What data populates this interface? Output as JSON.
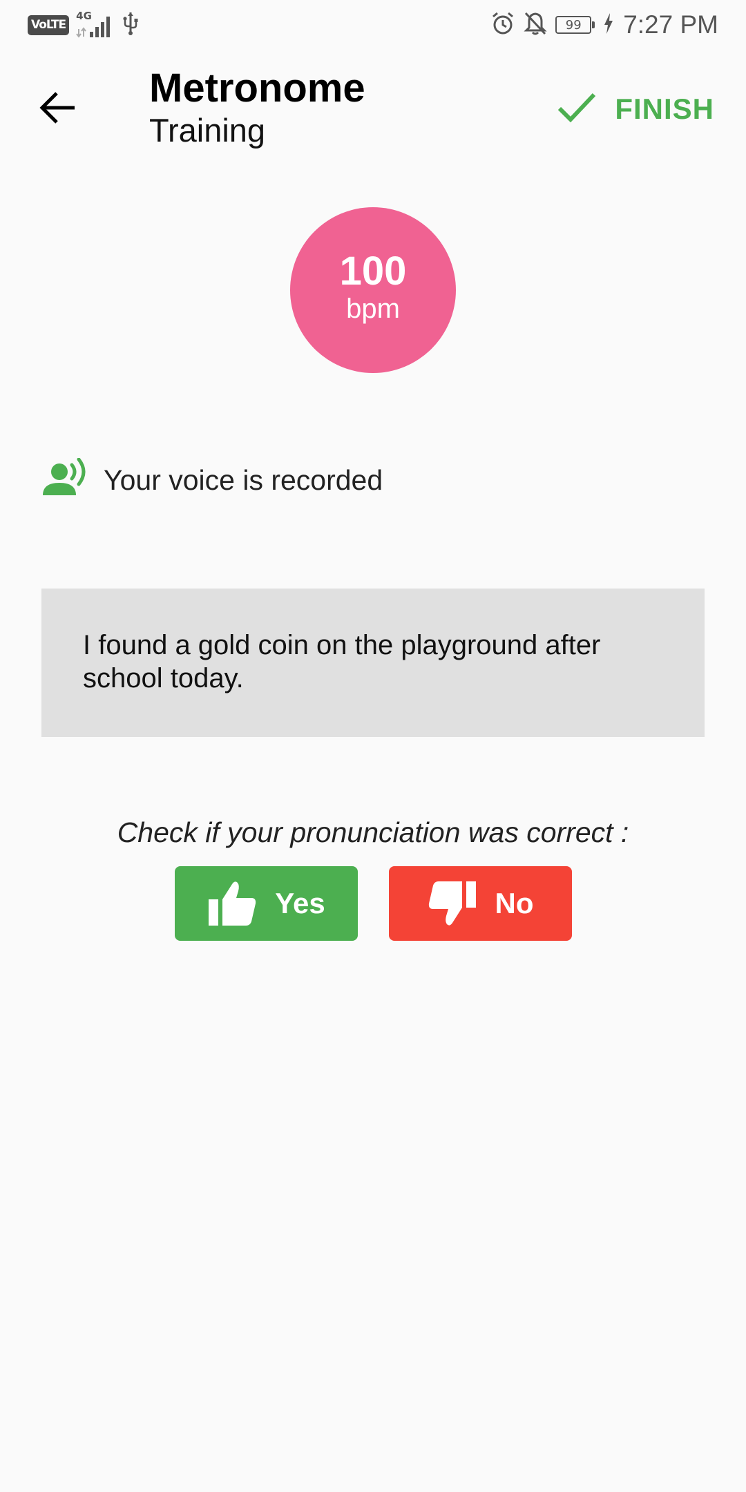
{
  "status_bar": {
    "volte": "VoLTE",
    "network": "4G",
    "battery": "99",
    "time": "7:27 PM",
    "icons": [
      "signal-icon",
      "usb-icon",
      "alarm-icon",
      "notifications-off-icon",
      "battery-icon",
      "charging-icon"
    ]
  },
  "toolbar": {
    "title": "Metronome",
    "subtitle": "Training",
    "finish_label": "FINISH",
    "back_icon": "arrow-back-icon",
    "finish_icon": "check-icon"
  },
  "tempo": {
    "value": "100",
    "unit": "bpm",
    "color": "#f06292"
  },
  "recording": {
    "icon": "voice-recording-icon",
    "label": "Your voice is recorded"
  },
  "sentence": {
    "text": "I found a gold coin on the playground after school today."
  },
  "feedback": {
    "prompt": "Check if your pronunciation was correct :",
    "yes_label": "Yes",
    "no_label": "No",
    "yes_icon": "thumb-up-icon",
    "no_icon": "thumb-down-icon"
  },
  "colors": {
    "accent": "#4caf50",
    "negative": "#f44336",
    "card_background": "#e0e0e0",
    "background": "#fafafa"
  }
}
